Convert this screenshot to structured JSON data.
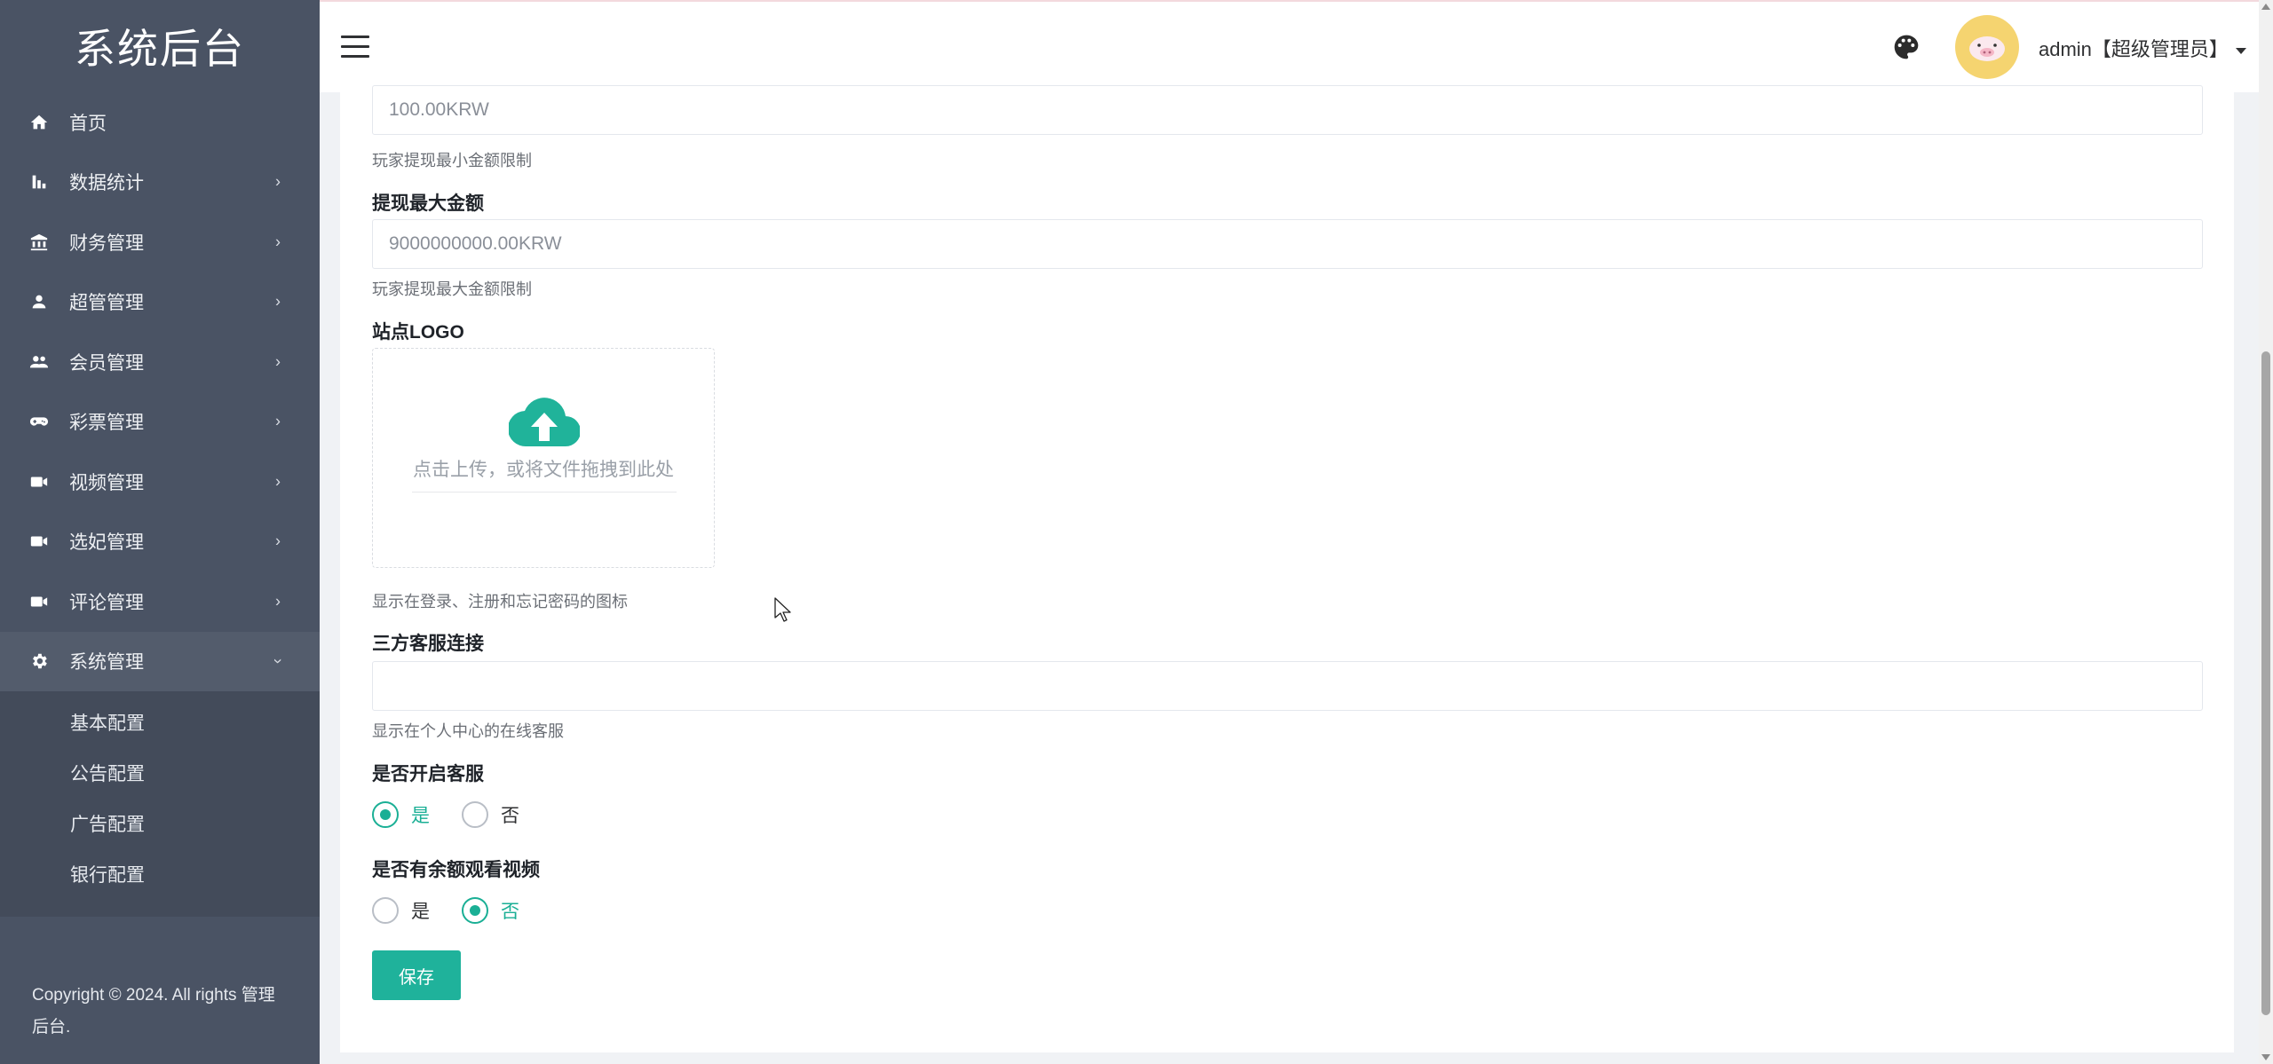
{
  "brand": "系统后台",
  "sidebar": {
    "items": [
      {
        "label": "首页",
        "icon": "home-icon",
        "arrow": ""
      },
      {
        "label": "数据统计",
        "icon": "bar-chart-icon",
        "arrow": "›"
      },
      {
        "label": "财务管理",
        "icon": "bank-icon",
        "arrow": "›"
      },
      {
        "label": "超管管理",
        "icon": "person-icon",
        "arrow": "›"
      },
      {
        "label": "会员管理",
        "icon": "people-icon",
        "arrow": "›"
      },
      {
        "label": "彩票管理",
        "icon": "gamepad-icon",
        "arrow": "›"
      },
      {
        "label": "视频管理",
        "icon": "video-camera-icon",
        "arrow": "›"
      },
      {
        "label": "选妃管理",
        "icon": "video-camera-icon",
        "arrow": "›"
      },
      {
        "label": "评论管理",
        "icon": "video-camera-icon",
        "arrow": "›"
      },
      {
        "label": "系统管理",
        "icon": "gear-icon",
        "arrow": "›"
      }
    ],
    "submenu": [
      "基本配置",
      "公告配置",
      "广告配置",
      "银行配置"
    ],
    "copyright": "Copyright © 2024. All rights 管理后台."
  },
  "header": {
    "username": "admin【超级管理员】"
  },
  "form": {
    "min_withdraw_value": "100.00KRW",
    "min_withdraw_hint": "玩家提现最小金额限制",
    "max_withdraw_label": "提现最大金额",
    "max_withdraw_value": "9000000000.00KRW",
    "max_withdraw_hint": "玩家提现最大金额限制",
    "logo_label": "站点LOGO",
    "upload_text": "点击上传，或将文件拖拽到此处",
    "logo_hint": "显示在登录、注册和忘记密码的图标",
    "service_link_label": "三方客服连接",
    "service_link_value": "",
    "service_link_hint": "显示在个人中心的在线客服",
    "open_service_label": "是否开启客服",
    "open_service_options": [
      "是",
      "否"
    ],
    "open_service_selected": "是",
    "balance_video_label": "是否有余额观看视频",
    "balance_video_options": [
      "是",
      "否"
    ],
    "balance_video_selected": "否",
    "save_label": "保存"
  },
  "colors": {
    "sidebar_bg": "#4a5364",
    "accent": "#1fb29b",
    "avatar_bg": "#f5d470"
  }
}
